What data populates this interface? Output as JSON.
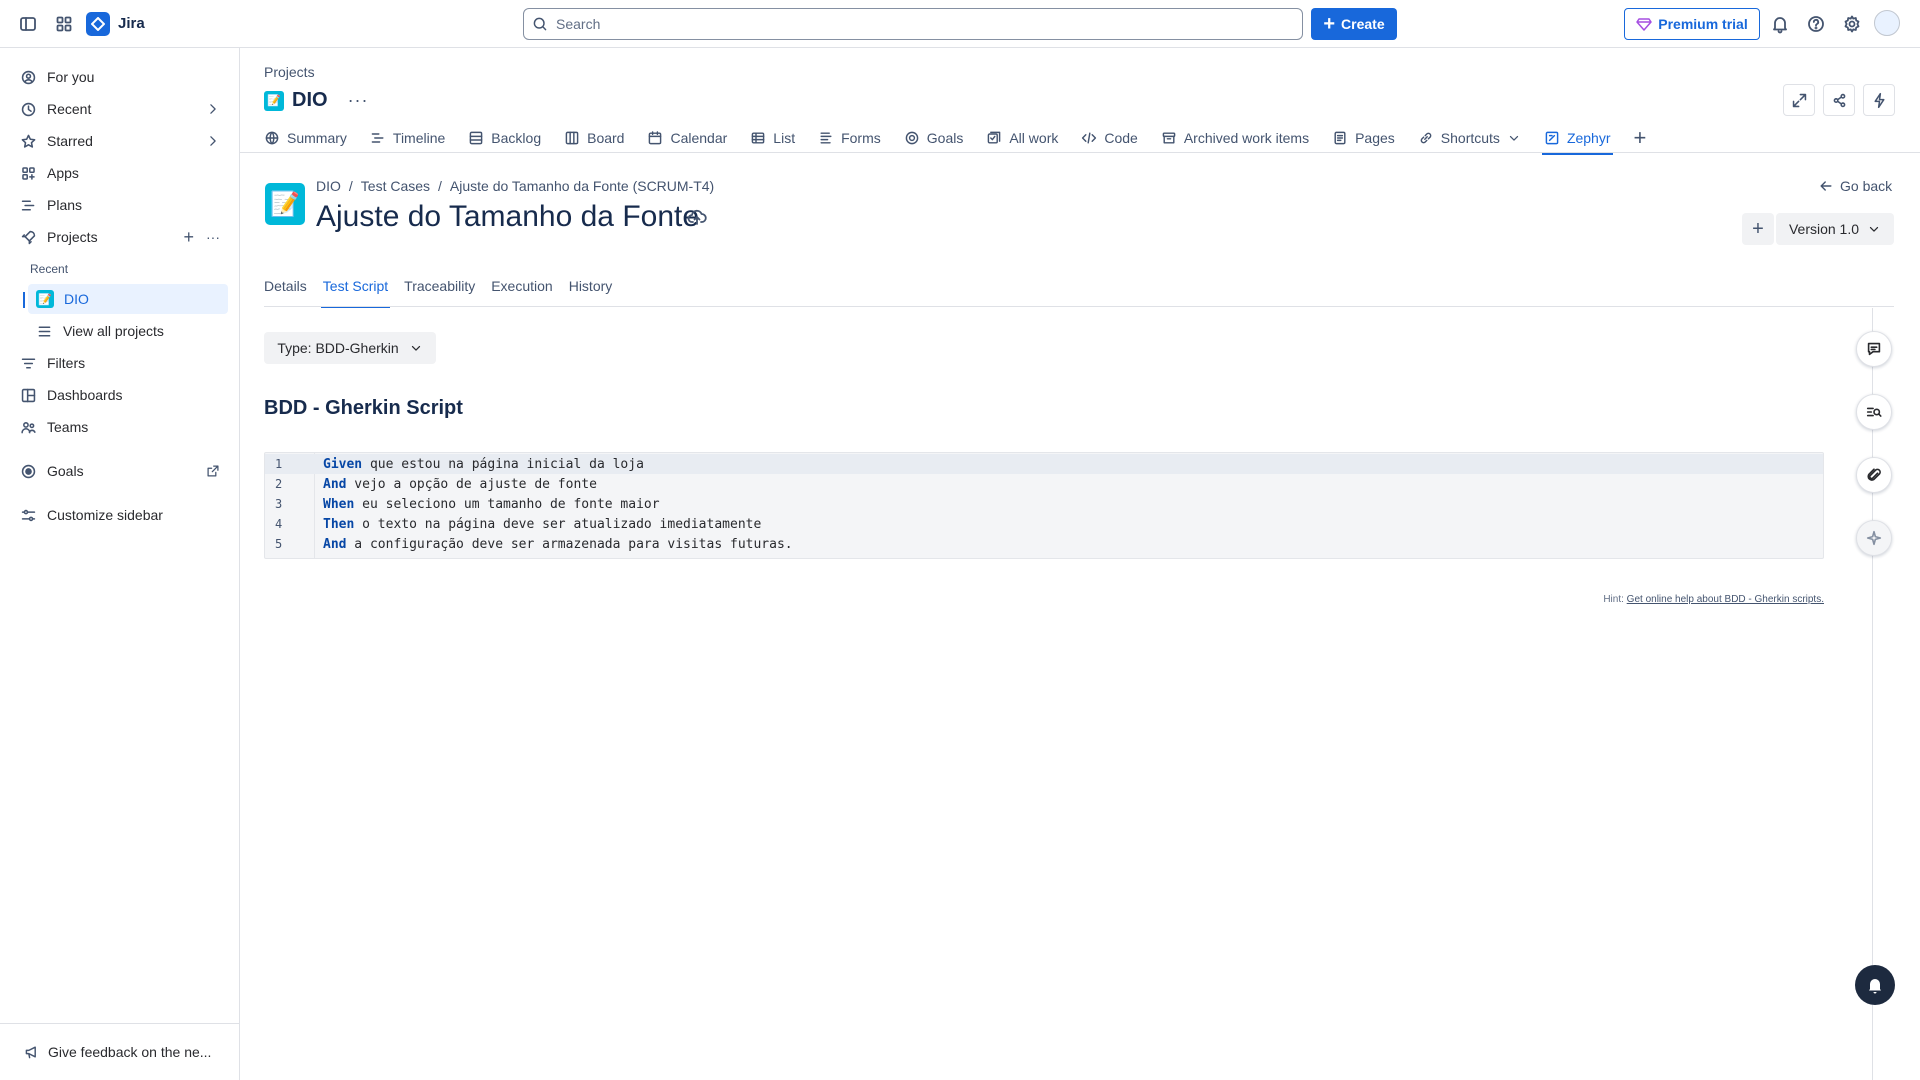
{
  "app": {
    "name": "Jira"
  },
  "search": {
    "placeholder": "Search"
  },
  "topbar": {
    "create_label": "Create",
    "premium_label": "Premium trial"
  },
  "sidebar": {
    "for_you": "For you",
    "recent": "Recent",
    "starred": "Starred",
    "apps": "Apps",
    "plans": "Plans",
    "projects": "Projects",
    "recent_section": "Recent",
    "project_dio": "DIO",
    "view_all_projects": "View all projects",
    "filters": "Filters",
    "dashboards": "Dashboards",
    "teams": "Teams",
    "goals": "Goals",
    "customize": "Customize sidebar",
    "feedback": "Give feedback on the ne..."
  },
  "project": {
    "breadcrumb": "Projects",
    "name": "DIO",
    "tabs": [
      "Summary",
      "Timeline",
      "Backlog",
      "Board",
      "Calendar",
      "List",
      "Forms",
      "Goals",
      "All work",
      "Code",
      "Archived work items",
      "Pages",
      "Shortcuts",
      "Zephyr"
    ],
    "active_tab": "Zephyr"
  },
  "test_case": {
    "breadcrumbs": [
      "DIO",
      "/",
      "Test Cases",
      "/",
      "Ajuste do Tamanho da Fonte (SCRUM-T4)"
    ],
    "title": "Ajuste do Tamanho da Fonte",
    "go_back": "Go back",
    "version_label": "Version 1.0",
    "tabs": [
      "Details",
      "Test Script",
      "Traceability",
      "Execution",
      "History"
    ],
    "active_tab": "Test Script",
    "type_label": "Type: BDD-Gherkin",
    "section_heading": "BDD - Gherkin Script",
    "script_lines": [
      {
        "number": "1",
        "keyword": "Given",
        "text": " que estou na página inicial da loja"
      },
      {
        "number": "2",
        "keyword": "And",
        "text": " vejo a opção de ajuste de fonte"
      },
      {
        "number": "3",
        "keyword": "When",
        "text": " eu seleciono um tamanho de fonte maior"
      },
      {
        "number": "4",
        "keyword": "Then",
        "text": " o texto na página deve ser atualizado imediatamente"
      },
      {
        "number": "5",
        "keyword": "And",
        "text": " a configuração deve ser armazenada para visitas futuras."
      }
    ],
    "hint_prefix": "Hint:",
    "hint_link": "Get online help about BDD - Gherkin scripts."
  },
  "colors": {
    "accent": "#1868db",
    "project_icon": "#00b8d9",
    "keyword": "#0747a6"
  }
}
